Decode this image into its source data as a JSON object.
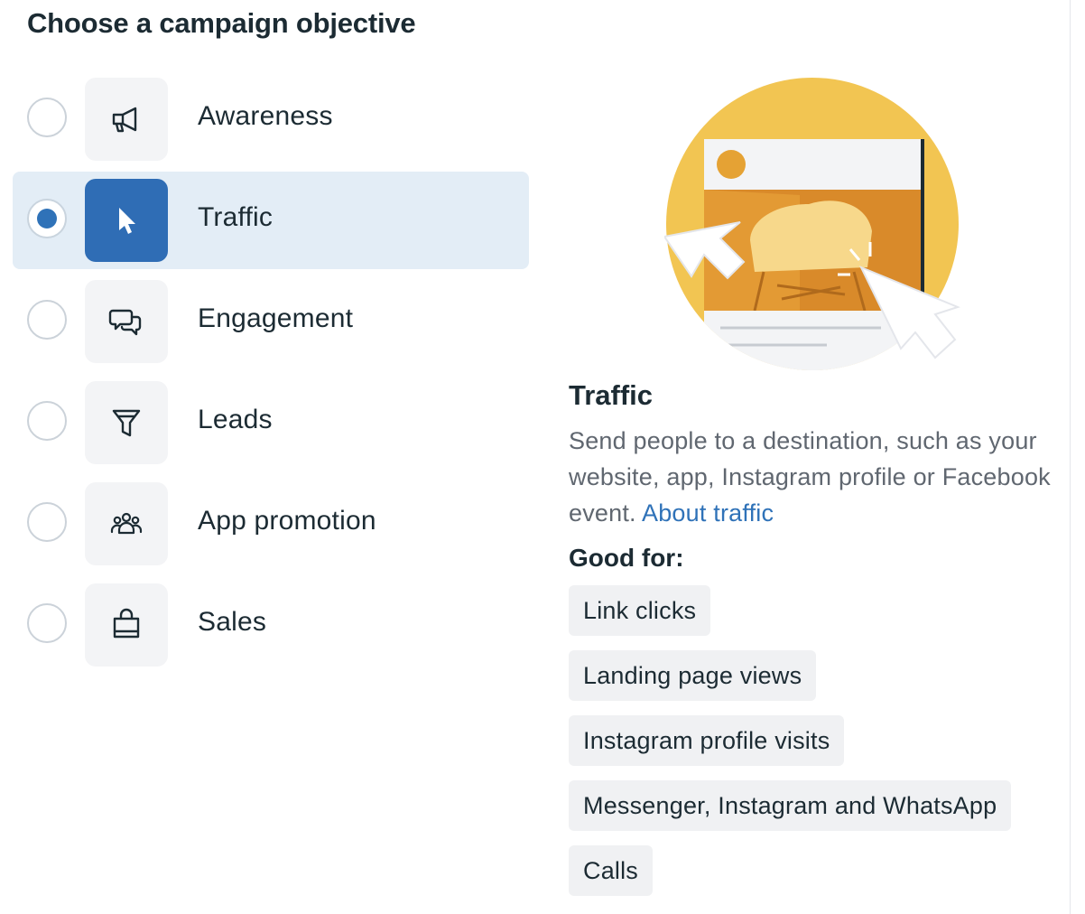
{
  "page_title": "Choose a campaign objective",
  "objectives": [
    {
      "label": "Awareness",
      "icon": "megaphone-icon",
      "selected": false
    },
    {
      "label": "Traffic",
      "icon": "cursor-icon",
      "selected": true
    },
    {
      "label": "Engagement",
      "icon": "chat-bubbles-icon",
      "selected": false
    },
    {
      "label": "Leads",
      "icon": "filter-icon",
      "selected": false
    },
    {
      "label": "App promotion",
      "icon": "people-group-icon",
      "selected": false
    },
    {
      "label": "Sales",
      "icon": "shopping-bag-icon",
      "selected": false
    }
  ],
  "detail": {
    "title": "Traffic",
    "description": "Send people to a destination, such as your website, app, Instagram profile or Facebook event.",
    "link_text": "About traffic",
    "good_for_heading": "Good for:",
    "good_for": [
      "Link clicks",
      "Landing page views",
      "Instagram profile visits",
      "Messenger, Instagram and WhatsApp",
      "Calls"
    ]
  },
  "colors": {
    "accent": "#2f72b8",
    "selected_row_bg": "#e3edf6",
    "illustration_yellow": "#f2c552",
    "illustration_orange": "#d98a2a"
  }
}
